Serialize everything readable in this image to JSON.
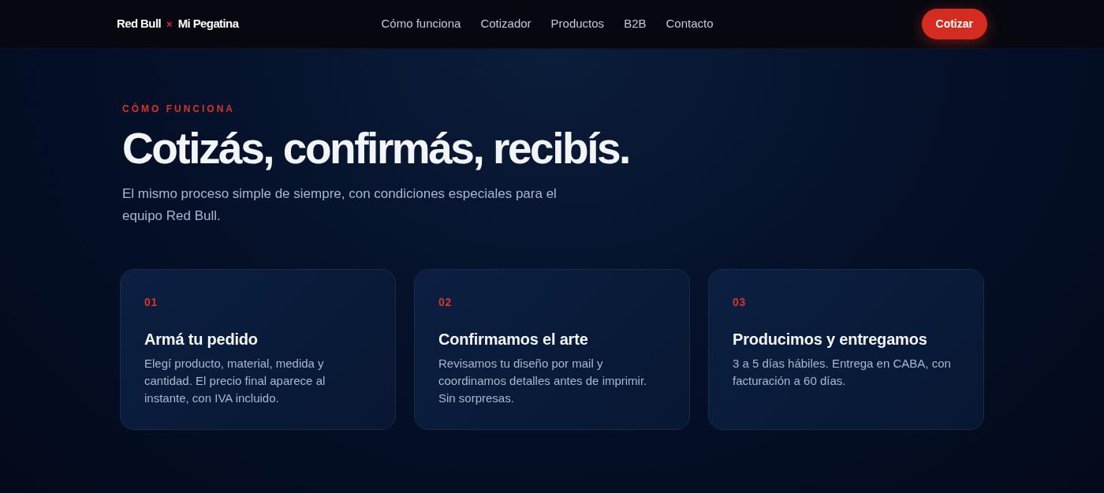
{
  "header": {
    "brand": {
      "left": "Red Bull",
      "separator": "×",
      "right": "Mi Pegatina"
    },
    "nav": [
      {
        "label": "Cómo funciona"
      },
      {
        "label": "Cotizador"
      },
      {
        "label": "Productos"
      },
      {
        "label": "B2B"
      },
      {
        "label": "Contacto"
      }
    ],
    "cta": "Cotizar"
  },
  "section": {
    "eyebrow": "CÓMO FUNCIONA",
    "title": "Cotizás, confirmás, recibís.",
    "subtitle": "El mismo proceso simple de siempre, con condiciones especiales para el equipo Red Bull.",
    "steps": [
      {
        "number": "01",
        "title": "Armá tu pedido",
        "text": "Elegí producto, material, medida y cantidad. El precio final aparece al instante, con IVA incluido."
      },
      {
        "number": "02",
        "title": "Confirmamos el arte",
        "text": "Revisamos tu diseño por mail y coordinamos detalles antes de imprimir. Sin sorpresas."
      },
      {
        "number": "03",
        "title": "Producimos y entregamos",
        "text": "3 a 5 días hábiles. Entrega en CABA, con facturación a 60 días."
      }
    ]
  }
}
